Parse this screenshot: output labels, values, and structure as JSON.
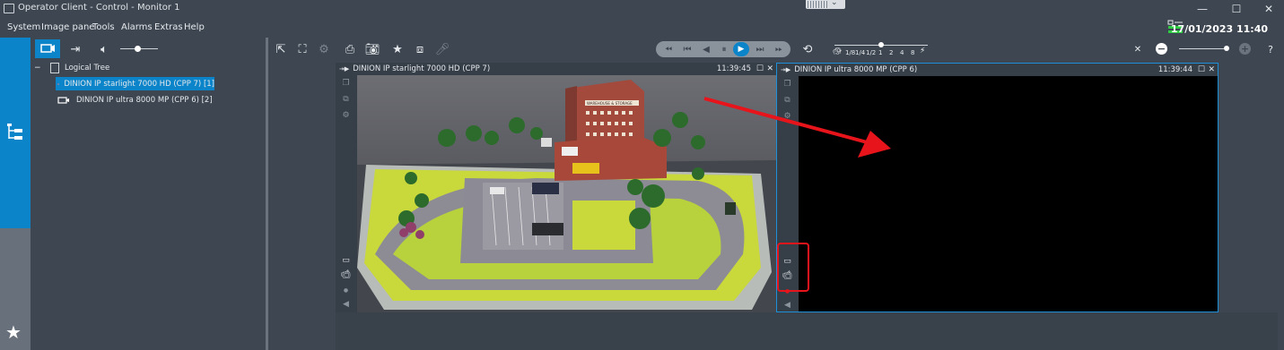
{
  "window": {
    "title": "Operator Client - Control - Monitor 1",
    "datetime": "17/01/2023 11:40"
  },
  "menu": [
    "System",
    "Image pane",
    "Tools",
    "Alarms",
    "Extras",
    "Help"
  ],
  "toolbar": {
    "playback_speeds": [
      "1/8",
      "1/4",
      "1/2",
      "1",
      "2",
      "4",
      "8"
    ],
    "help_label": "?"
  },
  "tree": {
    "root_label": "Logical Tree",
    "items": [
      {
        "label": "DINION IP starlight 7000 HD (CPP 7) [1]",
        "selected": true
      },
      {
        "label": "DINION IP ultra 8000 MP (CPP 6) [2]",
        "selected": false
      }
    ]
  },
  "panes": [
    {
      "title": "DINION IP starlight 7000 HD (CPP 7)",
      "time": "11:39:45"
    },
    {
      "title": "DINION IP ultra 8000 MP (CPP 6)",
      "time": "11:39:44"
    }
  ],
  "scene": {
    "building_sign": "WAREHOUSE & STORAGE"
  },
  "colors": {
    "accent": "#0b84c9",
    "annotation": "#e8141b",
    "background": "#3d4651"
  }
}
